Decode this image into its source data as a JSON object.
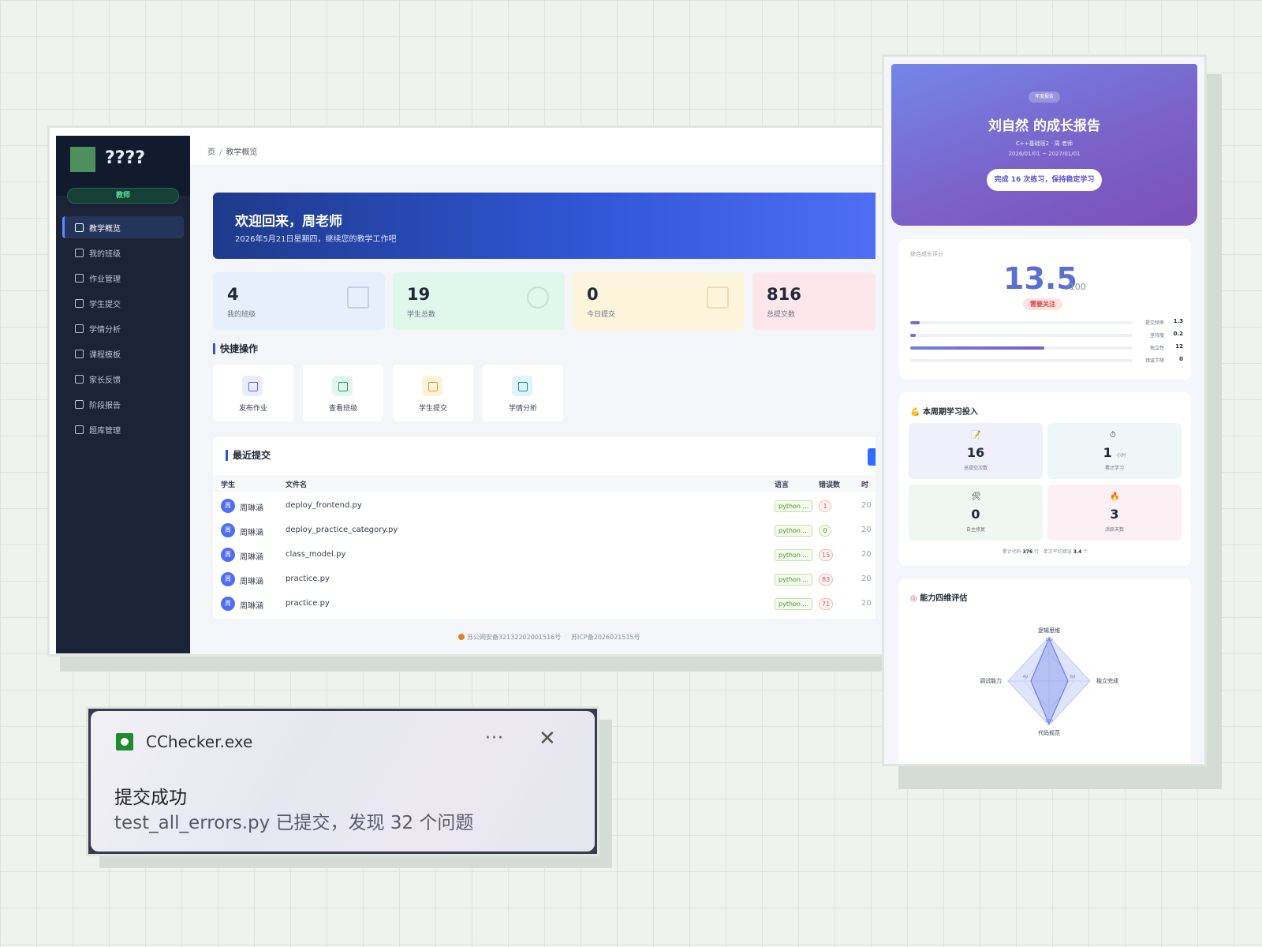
{
  "dashboard": {
    "app_title": "????",
    "role": "教师",
    "nav": [
      {
        "label": "教学概览",
        "active": true
      },
      {
        "label": "我的班级"
      },
      {
        "label": "作业管理"
      },
      {
        "label": "学生提交"
      },
      {
        "label": "学情分析"
      },
      {
        "label": "课程模板"
      },
      {
        "label": "家长反馈"
      },
      {
        "label": "阶段报告"
      },
      {
        "label": "题库管理"
      }
    ],
    "breadcrumb": {
      "home": "页",
      "current": "教学概览"
    },
    "welcome": {
      "title": "欢迎回来，周老师",
      "subtitle": "2026年5月21日星期四，继续您的教学工作吧"
    },
    "stats": [
      {
        "value": "4",
        "label": "我的班级",
        "icon": "book-icon"
      },
      {
        "value": "19",
        "label": "学生总数",
        "icon": "user-icon"
      },
      {
        "value": "0",
        "label": "今日提交",
        "icon": "file-check-icon"
      },
      {
        "value": "816",
        "label": "总提交数",
        "icon": "upload-icon"
      }
    ],
    "quick_title": "快捷操作",
    "quick_actions": [
      {
        "label": "发布作业",
        "icon": "edit-icon",
        "color": "#4f6ef5"
      },
      {
        "label": "查看班级",
        "icon": "book-icon",
        "color": "#22a06b"
      },
      {
        "label": "学生提交",
        "icon": "file-icon",
        "color": "#e0a020"
      },
      {
        "label": "学情分析",
        "icon": "chart-icon",
        "color": "#0891b2"
      }
    ],
    "recent_title": "最近提交",
    "table": {
      "headers": [
        "学生",
        "文件名",
        "语言",
        "错误数",
        "时"
      ],
      "rows": [
        {
          "avatar": "周",
          "student": "周琳涵",
          "file": "deploy_frontend.py",
          "lang": "python ...",
          "errors": "1",
          "time": "20"
        },
        {
          "avatar": "周",
          "student": "周琳涵",
          "file": "deploy_practice_category.py",
          "lang": "python ...",
          "errors": "0",
          "time": "20"
        },
        {
          "avatar": "周",
          "student": "周琳涵",
          "file": "class_model.py",
          "lang": "python ...",
          "errors": "15",
          "time": "20"
        },
        {
          "avatar": "周",
          "student": "周琳涵",
          "file": "practice.py",
          "lang": "python ...",
          "errors": "83",
          "time": "20"
        },
        {
          "avatar": "周",
          "student": "周琳涵",
          "file": "practice.py",
          "lang": "python ...",
          "errors": "71",
          "time": "20"
        }
      ]
    },
    "footer": {
      "police": "苏公网安备32132202001516号",
      "icp": "苏ICP备2026021515号"
    }
  },
  "report": {
    "tag": "年度报告",
    "title": "刘自然 的成长报告",
    "sub": "C++基础班2  ·  周 老师",
    "date": "2026/01/01 ~ 2027/01/01",
    "pill": "完成 16 次练习，保持稳定学习",
    "score_label": "综合成长评分",
    "score": "13.5",
    "score_unit": "/100",
    "score_badge": "需要关注",
    "bars": [
      {
        "name": "提交频率",
        "value": "1.3",
        "pct": 0.03
      },
      {
        "name": "坚持度",
        "value": "0.2",
        "pct": 0.01
      },
      {
        "name": "独立性",
        "value": "12",
        "pct": 0.59
      },
      {
        "name": "错误下降",
        "value": "0",
        "pct": 0
      }
    ],
    "input_title": "本周期学习投入",
    "tiles": [
      {
        "icon": "📝",
        "value": "16",
        "unit": "",
        "label": "总提交次数"
      },
      {
        "icon": "⏱",
        "value": "1",
        "unit": "小时",
        "label": "累计学习"
      },
      {
        "icon": "🛠",
        "value": "0",
        "unit": "",
        "label": "自主修复"
      },
      {
        "icon": "🔥",
        "value": "3",
        "unit": "",
        "label": "活跃天数"
      }
    ],
    "input_foot": {
      "pre": "累计代码",
      "lines": "376",
      "mid": "行 · 单次平均错误",
      "avg": "3.4",
      "post": "个"
    },
    "radar_title": "能力四维评估",
    "radar": {
      "axes": [
        "逻辑思维",
        "独立完成",
        "代码规范",
        "调试能力"
      ],
      "ticks": [
        "100",
        "60",
        "100",
        "40"
      ]
    }
  },
  "toast": {
    "app": "CChecker.exe",
    "more": "···",
    "close": "✕",
    "title": "提交成功",
    "message": "test_all_errors.py 已提交，发现 32 个问题"
  }
}
